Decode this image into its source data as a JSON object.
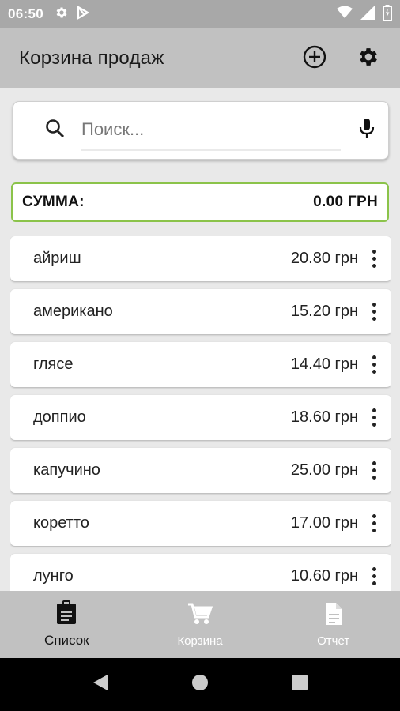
{
  "status_bar": {
    "time": "06:50"
  },
  "app_bar": {
    "title": "Корзина продаж"
  },
  "search": {
    "placeholder": "Поиск..."
  },
  "summary": {
    "label": "СУММА:",
    "value": "0.00 ГРН"
  },
  "products": [
    {
      "name": "айриш",
      "price": "20.80 грн"
    },
    {
      "name": "американо",
      "price": "15.20 грн"
    },
    {
      "name": "глясе",
      "price": "14.40 грн"
    },
    {
      "name": "доппио",
      "price": "18.60 грн"
    },
    {
      "name": "капучино",
      "price": "25.00 грн"
    },
    {
      "name": "коретто",
      "price": "17.00 грн"
    },
    {
      "name": "лунго",
      "price": "10.60 грн"
    }
  ],
  "bottom_nav": [
    {
      "label": "Список",
      "icon": "clipboard-icon",
      "active": true
    },
    {
      "label": "Корзина",
      "icon": "cart-icon",
      "active": false
    },
    {
      "label": "Отчет",
      "icon": "document-icon",
      "active": false
    }
  ],
  "colors": {
    "accent_border": "#8bc34a",
    "app_bar": "#c1c1c1",
    "status_bar": "#a8a8a8"
  }
}
